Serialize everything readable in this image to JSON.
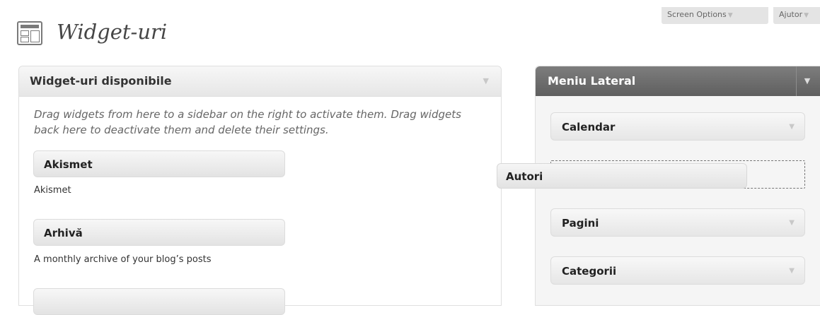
{
  "header": {
    "title": "Widget-uri",
    "screen_options_label": "Screen Options",
    "help_label": "Ajutor"
  },
  "available": {
    "title": "Widget-uri disponibile",
    "description": "Drag widgets from here to a sidebar on the right to activate them. Drag widgets back here to deactivate them and delete their settings.",
    "widgets": [
      {
        "title": "Akismet",
        "description": "Akismet"
      },
      {
        "title": "Arhivă",
        "description": "A monthly archive of your blog’s posts"
      }
    ]
  },
  "sidebar": {
    "title": "Meniu Lateral",
    "widgets": [
      "Calendar",
      "Pagini",
      "Categorii"
    ],
    "dragging_widget": "Autori"
  },
  "icons": {
    "toggle": "triangle-down-icon",
    "page": "widgets-page-icon"
  }
}
